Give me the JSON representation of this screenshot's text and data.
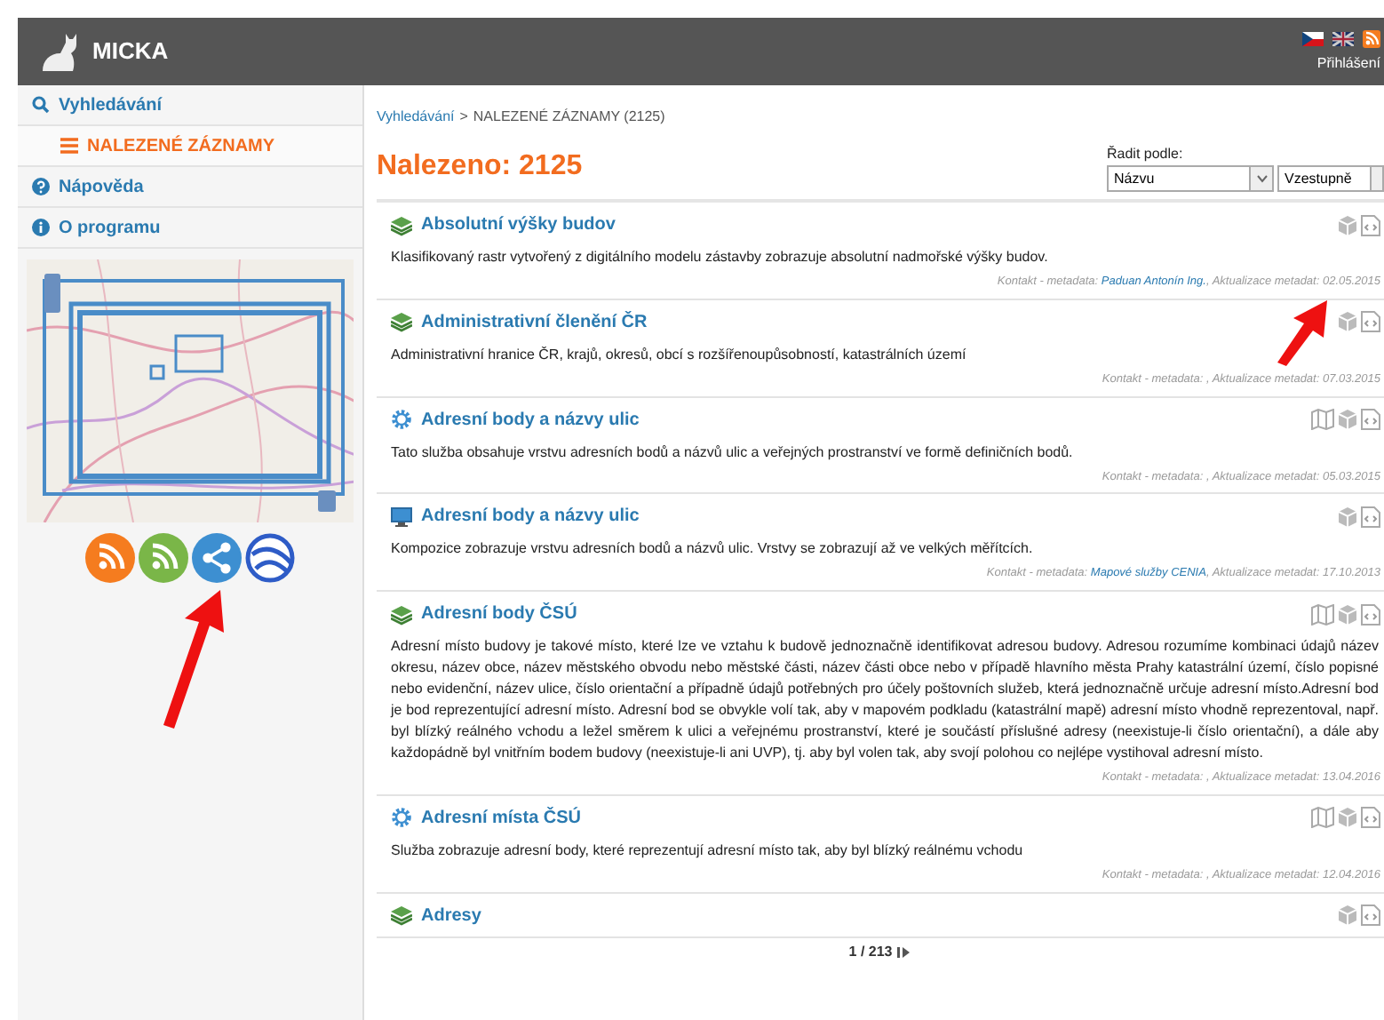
{
  "header": {
    "title": "MICKA",
    "languages": [
      {
        "kind": "cz",
        "selected": true
      },
      {
        "kind": "gb",
        "selected": false
      }
    ],
    "login": "Přihlášení"
  },
  "sidebar": {
    "items": [
      {
        "kind": "search",
        "label": "Vyhledávání",
        "selected": false,
        "children": [
          {
            "kind": "list",
            "label": "NALEZENÉ ZÁZNAMY",
            "selected": true
          }
        ]
      },
      {
        "kind": "help",
        "label": "Nápověda",
        "selected": false
      },
      {
        "kind": "info",
        "label": "O programu",
        "selected": false
      }
    ],
    "feeds": [
      {
        "kind": "rss",
        "color": "#f57c1f"
      },
      {
        "kind": "rss",
        "color": "#7ab648"
      },
      {
        "kind": "share",
        "color": "#3d8fd1"
      },
      {
        "kind": "globe",
        "color": "#2e5cc7"
      }
    ]
  },
  "breadcrumb": {
    "link": "Vyhledávání",
    "separator": ">",
    "current": "NALEZENÉ ZÁZNAMY (2125)"
  },
  "heading": "Nalezeno: 2125",
  "sort": {
    "label": "Řadit podle:",
    "field": "Názvu",
    "order": "Vzestupně"
  },
  "results": [
    {
      "kind": "layers",
      "title": "Absolutní výšky budov",
      "description": "Klasifikovaný rastr vytvořený z digitálního modelu zástavby zobrazuje absolutní nadmořské výšky budov.",
      "meta": {
        "before": "Kontakt - metadata: ",
        "contact": "Paduan Antonín Ing.",
        "after": ", Aktualizace metadat: 02.05.2015"
      },
      "actions": [
        {
          "kind": "box"
        },
        {
          "kind": "xml"
        }
      ]
    },
    {
      "kind": "layers",
      "title": "Administrativní členění ČR",
      "description": "Administrativní hranice ČR, krajů, okresů, obcí s rozšířenoupůsobností, katastrálních území",
      "meta": {
        "before": "Kontakt - metadata: , Aktualizace metadat: 07.03.2015"
      },
      "actions": [
        {
          "kind": "box"
        },
        {
          "kind": "xml"
        }
      ]
    },
    {
      "kind": "gear",
      "title": "Adresní body a názvy ulic",
      "description": "Tato služba obsahuje vrstvu adresních bodů a názvů ulic a veřejných prostranství ve formě definičních bodů.",
      "meta": {
        "before": "Kontakt - metadata: , Aktualizace metadat: 05.03.2015"
      },
      "actions": [
        {
          "kind": "map"
        },
        {
          "kind": "box"
        },
        {
          "kind": "xml"
        }
      ]
    },
    {
      "kind": "monitor",
      "title": "Adresní body a názvy ulic",
      "description": "Kompozice zobrazuje vrstvu adresních bodů a názvů ulic. Vrstvy se zobrazují až ve velkých měřítcích.",
      "meta": {
        "before": "Kontakt - metadata: ",
        "contact": "Mapové služby CENIA",
        "after": ", Aktualizace metadat: 17.10.2013"
      },
      "actions": [
        {
          "kind": "box"
        },
        {
          "kind": "xml"
        }
      ]
    },
    {
      "kind": "layers",
      "title": "Adresní body ČSÚ",
      "description": "Adresní místo budovy je takové místo, které lze ve vztahu k budově jednoznačně identifikovat adresou budovy. Adresou rozumíme kombinaci údajů název okresu, název obce, název městského obvodu nebo městské části, název části obce nebo v případě hlavního města Prahy katastrální území, číslo popisné nebo evidenční, název ulice, číslo orientační a případně údajů potřebných pro účely poštovních služeb, která jednoznačně určuje adresní místo.Adresní bod je bod reprezentující adresní místo. Adresní bod se obvykle volí tak, aby v mapovém podkladu (katastrální mapě) adresní místo vhodně reprezentoval, např. byl blízký reálného vchodu a ležel směrem k ulici a veřejnému prostranství, které je součástí příslušné adresy (neexistuje-li číslo orientační), a dále aby každopádně byl vnitřním bodem budovy (neexistuje-li ani UVP), tj. aby byl volen tak, aby svojí polohou co nejlépe vystihoval adresní místo.",
      "meta": {
        "before": "Kontakt - metadata: , Aktualizace metadat: 13.04.2016"
      },
      "actions": [
        {
          "kind": "map"
        },
        {
          "kind": "box"
        },
        {
          "kind": "xml"
        }
      ]
    },
    {
      "kind": "gear",
      "title": "Adresní místa ČSÚ",
      "description": "Služba zobrazuje adresní body, které reprezentují adresní místo tak, aby byl blízký reálnému vchodu",
      "meta": {
        "before": "Kontakt - metadata: , Aktualizace metadat: 12.04.2016"
      },
      "actions": [
        {
          "kind": "map"
        },
        {
          "kind": "box"
        },
        {
          "kind": "xml"
        }
      ]
    },
    {
      "kind": "layers",
      "title": "Adresy",
      "actions": [
        {
          "kind": "box"
        },
        {
          "kind": "xml"
        }
      ]
    }
  ],
  "pagination": {
    "text": "1 / 213"
  }
}
